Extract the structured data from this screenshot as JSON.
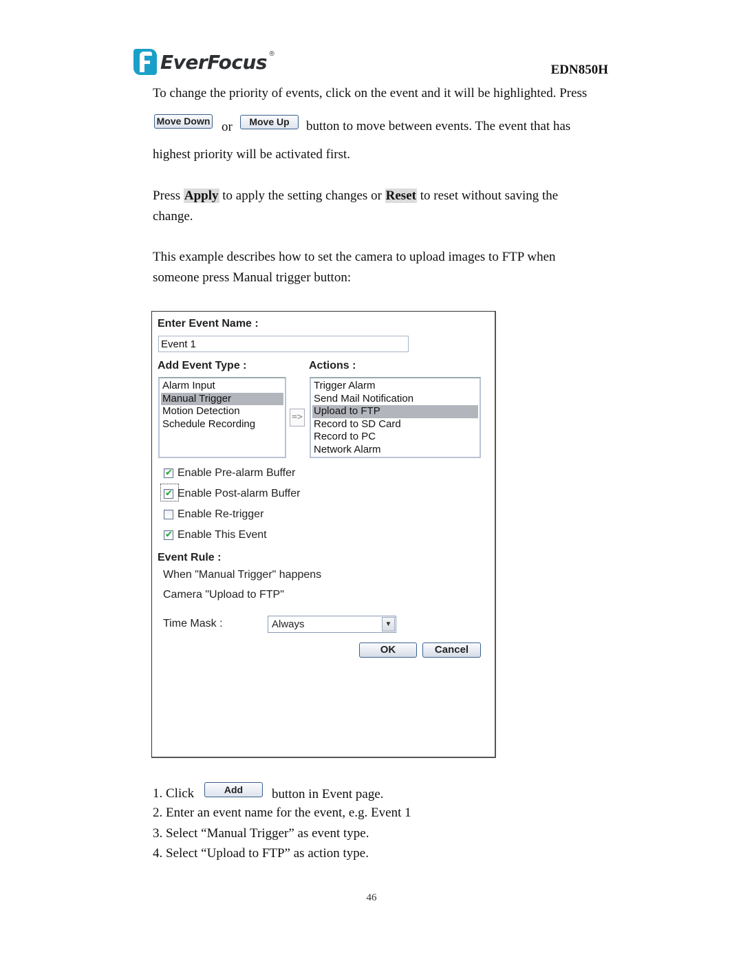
{
  "header": {
    "brand": "EverFocus",
    "brand_mark": "®",
    "model": "EDN850H",
    "brand_color": "#1aa0c8"
  },
  "intro": {
    "line1": "To change the priority of events, click on the event and it will be highlighted. Press",
    "move_down_label": "Move Down",
    "or": "or",
    "move_up_label": "Move Up",
    "line2_rest": "button to move between events. The event that has",
    "line3": "highest priority will be activated first."
  },
  "apply_para": {
    "press": "Press",
    "apply": "Apply",
    "middle": "to apply the setting changes or",
    "reset": "Reset",
    "end": "to reset without saving the",
    "line2": "change."
  },
  "example_para": {
    "line1": "This example describes how to set the camera to upload images to FTP when",
    "line2": "someone press Manual trigger button:"
  },
  "dialog": {
    "event_name_label": "Enter Event Name :",
    "event_name_value": "Event 1",
    "event_type_label": "Add Event Type :",
    "event_types": [
      {
        "label": "Alarm Input",
        "selected": false
      },
      {
        "label": "Manual Trigger",
        "selected": true
      },
      {
        "label": "Motion Detection",
        "selected": false
      },
      {
        "label": "Schedule Recording",
        "selected": false
      }
    ],
    "arrow_label": "=>",
    "actions_label": "Actions :",
    "actions": [
      {
        "label": "Trigger Alarm",
        "selected": false
      },
      {
        "label": "Send Mail Notification",
        "selected": false
      },
      {
        "label": "Upload to FTP",
        "selected": true
      },
      {
        "label": "Record to SD Card",
        "selected": false
      },
      {
        "label": "Record to PC",
        "selected": false
      },
      {
        "label": "Network Alarm",
        "selected": false
      }
    ],
    "checkboxes": [
      {
        "label": "Enable Pre-alarm Buffer",
        "checked": true
      },
      {
        "label": "Enable Post-alarm Buffer",
        "checked": true,
        "focused": true
      },
      {
        "label": "Enable Re-trigger",
        "checked": false
      },
      {
        "label": "Enable This Event",
        "checked": true
      }
    ],
    "event_rule_label": "Event Rule :",
    "rule_when": "When \"Manual Trigger\" happens",
    "rule_camera": "Camera \"Upload to FTP\"",
    "time_mask_label": "Time Mask :",
    "time_mask_value": "Always",
    "ok_label": "OK",
    "cancel_label": "Cancel"
  },
  "steps": {
    "s1_prefix": "1. Click",
    "add_label": "Add",
    "s1_suffix": "button in Event page.",
    "s2": "2. Enter an event name for the event, e.g. Event 1",
    "s3": "3. Select “Manual Trigger” as event type.",
    "s4": "4. Select “Upload to FTP” as action type."
  },
  "page_number": "46"
}
